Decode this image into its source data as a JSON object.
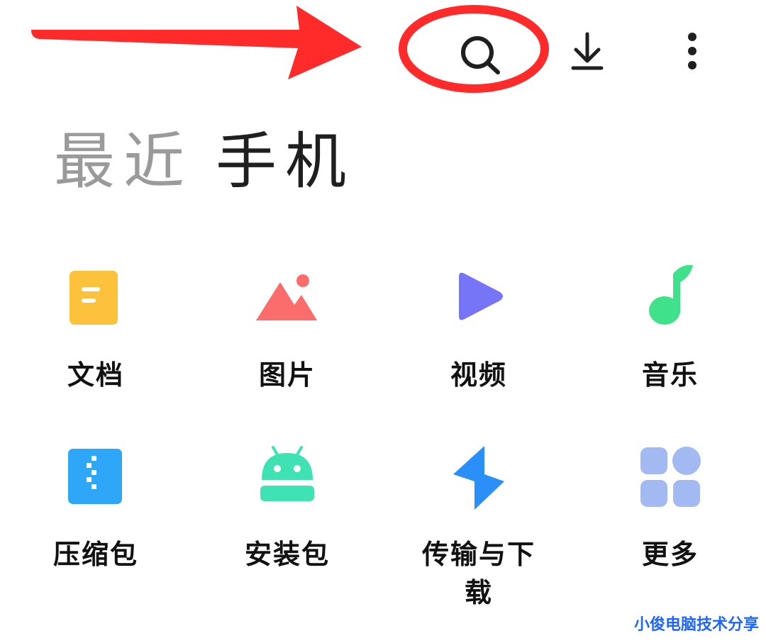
{
  "toolbar": {
    "search_icon": "search-icon",
    "download_icon": "download-icon",
    "more_icon": "more-vertical-icon"
  },
  "tabs": [
    {
      "label": "最近",
      "active": false
    },
    {
      "label": "手机",
      "active": true
    }
  ],
  "categories": [
    {
      "label": "文档",
      "icon": "document-icon",
      "color": "#FCC23C"
    },
    {
      "label": "图片",
      "icon": "image-icon",
      "color": "#FB6D6D"
    },
    {
      "label": "视频",
      "icon": "video-icon",
      "color": "#7675F7"
    },
    {
      "label": "音乐",
      "icon": "music-icon",
      "color": "#3FE28A"
    },
    {
      "label": "压缩包",
      "icon": "archive-icon",
      "color": "#2EA7F8"
    },
    {
      "label": "安装包",
      "icon": "android-icon",
      "color": "#3FE2B2"
    },
    {
      "label": "传输与下载",
      "icon": "transfer-icon",
      "color": "#2A8FF7"
    },
    {
      "label": "更多",
      "icon": "more-grid-icon",
      "color": "#A2B9F2"
    }
  ],
  "annotation": {
    "arrow_color": "#FF2A2A",
    "circle_color": "#FF2A2A"
  },
  "watermark": "小俊电脑技术分享"
}
